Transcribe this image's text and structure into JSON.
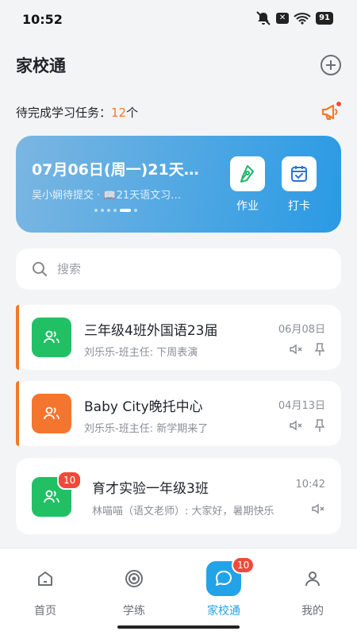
{
  "status_bar": {
    "time": "10:52",
    "battery": "91"
  },
  "header": {
    "title": "家校通"
  },
  "tasks": {
    "label": "待完成学习任务：",
    "count": "12",
    "unit": "个"
  },
  "banner": {
    "title": "07月06日(周一)21天…",
    "subtitle": "吴小娴待提交 · 📖21天语文习…",
    "homework_label": "作业",
    "checkin_label": "打卡"
  },
  "search": {
    "placeholder": "搜索"
  },
  "chats": [
    {
      "name": "三年级4班外国语23届",
      "date": "06月08日",
      "message": "刘乐乐-班主任: 下周表演",
      "avatar_color": "#21c065"
    },
    {
      "name": "Baby City晚托中心",
      "date": "04月13日",
      "message": "刘乐乐-班主任: 新学期来了",
      "avatar_color": "#f4752e"
    },
    {
      "name": "育才实验一年级3班",
      "date": "10:42",
      "message": "林喵喵（语文老师）: 大家好，暑期快乐",
      "badge": "10",
      "avatar_color": "#21c065"
    }
  ],
  "tabbar": {
    "items": [
      {
        "label": "首页",
        "icon": "home-icon"
      },
      {
        "label": "学练",
        "icon": "target-icon"
      },
      {
        "label": "家校通",
        "icon": "chat-bubble-icon",
        "badge": "10"
      },
      {
        "label": "我的",
        "icon": "person-icon"
      }
    ],
    "active_color": "#22a3e8"
  }
}
